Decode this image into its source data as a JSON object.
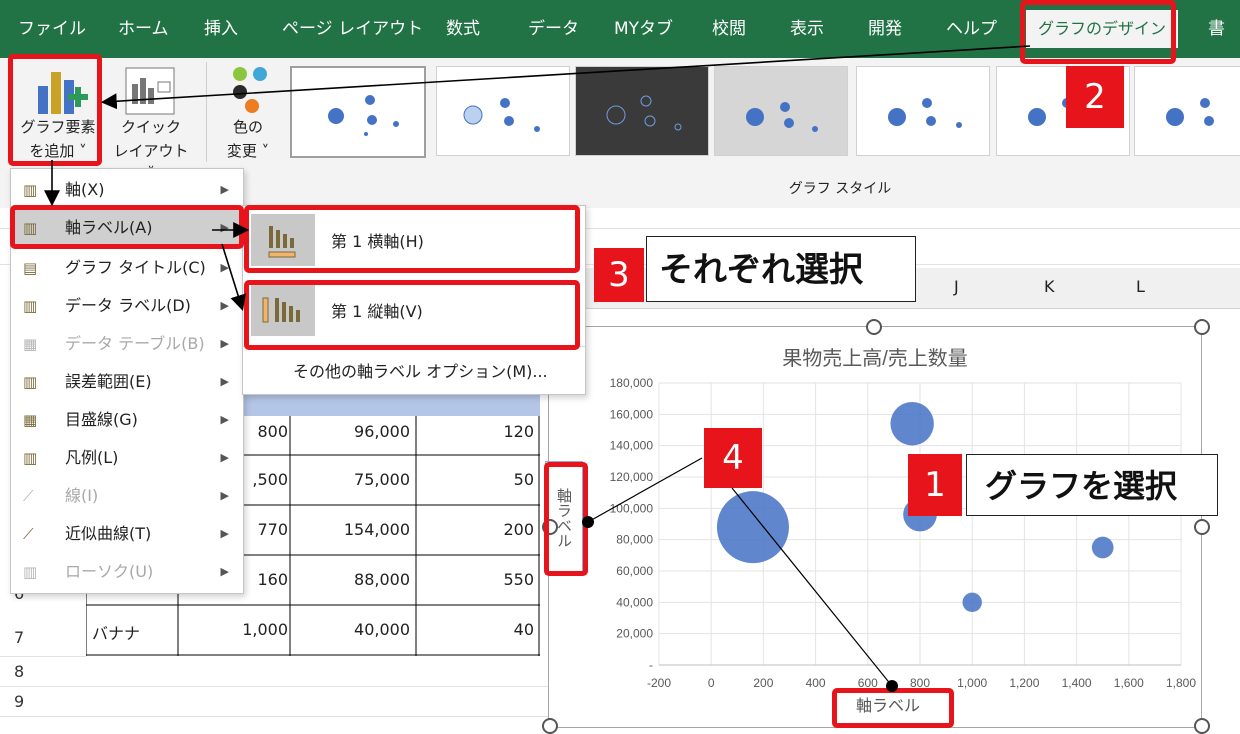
{
  "ribbon": {
    "tabs": [
      "ファイル",
      "ホーム",
      "挿入",
      "ページ レイアウト",
      "数式",
      "データ",
      "MYタブ",
      "校閲",
      "表示",
      "開発",
      "ヘルプ",
      "グラフのデザイン",
      "書"
    ],
    "add_element_label_1": "グラフ要素",
    "add_element_label_2": "を追加 ˅",
    "quick_layout_label_1": "クイック",
    "quick_layout_label_2": "レイアウト ˅",
    "change_color_label_1": "色の",
    "change_color_label_2": "変更 ˅",
    "styles_group_label": "グラフ スタイル"
  },
  "menu": {
    "items": [
      {
        "label": "軸(X)",
        "disabled": false,
        "icon": "axis-icon"
      },
      {
        "label": "軸ラベル(A)",
        "disabled": false,
        "icon": "axis-label-icon"
      },
      {
        "label": "グラフ タイトル(C)",
        "disabled": false,
        "icon": "chart-title-icon"
      },
      {
        "label": "データ ラベル(D)",
        "disabled": false,
        "icon": "data-label-icon"
      },
      {
        "label": "データ テーブル(B)",
        "disabled": true,
        "icon": "data-table-icon"
      },
      {
        "label": "誤差範囲(E)",
        "disabled": false,
        "icon": "error-bars-icon"
      },
      {
        "label": "目盛線(G)",
        "disabled": false,
        "icon": "gridlines-icon"
      },
      {
        "label": "凡例(L)",
        "disabled": false,
        "icon": "legend-icon"
      },
      {
        "label": "線(I)",
        "disabled": true,
        "icon": "lines-icon"
      },
      {
        "label": "近似曲線(T)",
        "disabled": false,
        "icon": "trendline-icon"
      },
      {
        "label": "ローソク(U)",
        "disabled": true,
        "icon": "updown-bars-icon"
      }
    ]
  },
  "submenu": {
    "horizontal": "第 1 横軸(H)",
    "vertical": "第 1 縦軸(V)",
    "more": "その他の軸ラベル オプション(M)..."
  },
  "sheet": {
    "columns": [
      "J",
      "K",
      "L"
    ],
    "row_numbers": [
      "6",
      "7",
      "8",
      "9"
    ],
    "rows": [
      {
        "a": "",
        "b": "800",
        "c": "96,000",
        "d": "120"
      },
      {
        "a": "",
        "b": ",500",
        "c": "75,000",
        "d": "50"
      },
      {
        "a": "",
        "b": "770",
        "c": "154,000",
        "d": "200"
      },
      {
        "a": "",
        "b": "160",
        "c": "88,000",
        "d": "550"
      },
      {
        "a": "バナナ",
        "b": "1,000",
        "c": "40,000",
        "d": "40"
      }
    ]
  },
  "annotations": {
    "step1_num": "1",
    "step1_text": "グラフを選択",
    "step2_num": "2",
    "step3_num": "3",
    "step3_text": "それぞれ選択",
    "step4_num": "4"
  },
  "colors": {
    "accent": "#217346",
    "highlight": "#e8141b",
    "bubble": "#4472c4"
  },
  "chart_data": {
    "type": "scatter",
    "title": "果物売上高/売上数量",
    "xlabel": "軸ラベル",
    "ylabel": "軸ラベル",
    "xlim": [
      -200,
      1800
    ],
    "ylim": [
      0,
      180000
    ],
    "x_ticks": [
      "-200",
      "0",
      "200",
      "400",
      "600",
      "800",
      "1,000",
      "1,200",
      "1,400",
      "1,600",
      "1,800"
    ],
    "y_ticks": [
      "-",
      "20,000",
      "40,000",
      "60,000",
      "80,000",
      "100,000",
      "120,000",
      "140,000",
      "160,000",
      "180,000"
    ],
    "points": [
      {
        "x": 800,
        "y": 96000,
        "size": 120
      },
      {
        "x": 1500,
        "y": 75000,
        "size": 50
      },
      {
        "x": 770,
        "y": 154000,
        "size": 200
      },
      {
        "x": 160,
        "y": 88000,
        "size": 550
      },
      {
        "x": 1000,
        "y": 40000,
        "size": 40
      }
    ]
  }
}
